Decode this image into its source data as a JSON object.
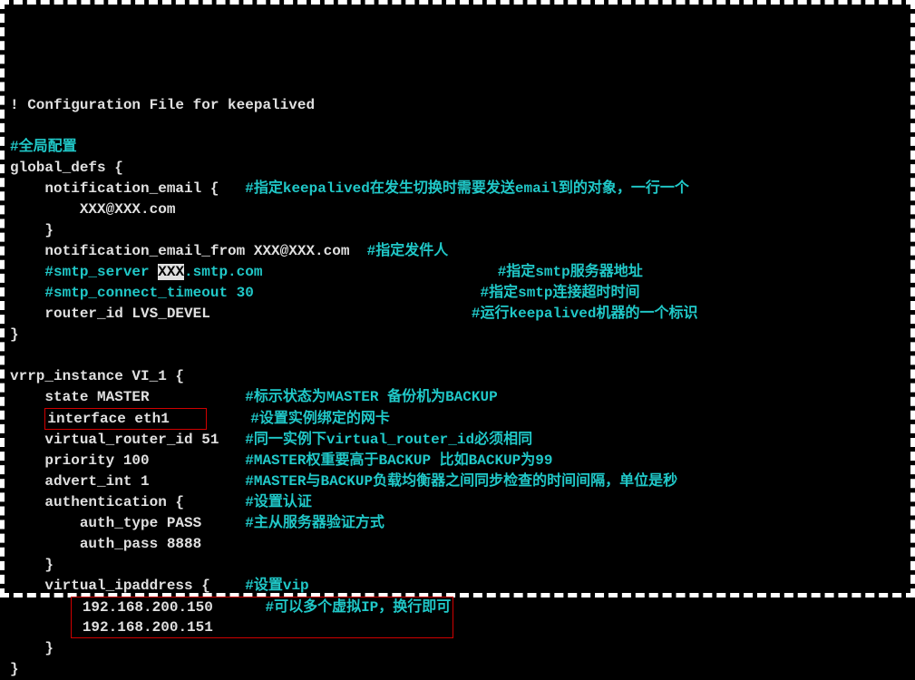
{
  "lines": {
    "l1": "! Configuration File for keepalived",
    "l3": "#全局配置",
    "l4": "global_defs {",
    "l5a": "    notification_email {   ",
    "l5c": "#指定keepalived在发生切换时需要发送email到的对象，一行一个",
    "l6": "        XXX@XXX.com",
    "l7": "    }",
    "l8a": "    notification_email_from XXX@XXX.com  ",
    "l8c": "#指定发件人",
    "l9a": "    #smtp_server ",
    "l9sel": "XXX",
    "l9b": ".smtp.com                           ",
    "l9c": "#指定smtp服务器地址",
    "l10a": "    #smtp_connect_timeout 30                          ",
    "l10c": "#指定smtp连接超时时间",
    "l11a": "    router_id LVS_DEVEL                              ",
    "l11c": "#运行keepalived机器的一个标识",
    "l12": "}",
    "l14": "vrrp_instance VI_1 {",
    "l15a": "    state MASTER           ",
    "l15c": "#标示状态为MASTER 备份机为BACKUP",
    "l16pre": "    ",
    "l16box": "interface eth1    ",
    "l16sp": "     ",
    "l16c": "#设置实例绑定的网卡",
    "l17a": "    virtual_router_id 51   ",
    "l17c": "#同一实例下virtual_router_id必须相同",
    "l18a": "    priority 100           ",
    "l18c": "#MASTER权重要高于BACKUP 比如BACKUP为99",
    "l19a": "    advert_int 1           ",
    "l19c": "#MASTER与BACKUP负载均衡器之间同步检查的时间间隔，单位是秒",
    "l20a": "    authentication {       ",
    "l20c": "#设置认证",
    "l21a": "        auth_type PASS     ",
    "l21c": "#主从服务器验证方式",
    "l22": "        auth_pass 8888",
    "l23": "    }",
    "l24a": "    virtual_ipaddress {    ",
    "l24c": "#设置vip",
    "l25pre": "       ",
    "l25c": "#可以多个虚拟IP，换行即可",
    "l25box1": " 192.168.200.150 ",
    "l25box2": " 192.168.200.151 ",
    "l27": "    }",
    "l28": "}"
  }
}
